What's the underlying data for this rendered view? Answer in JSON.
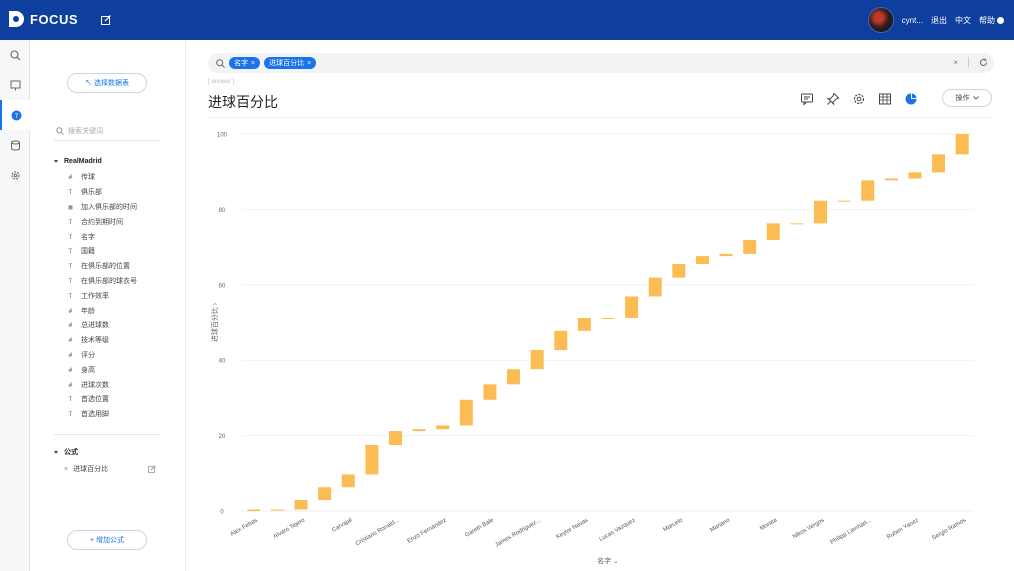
{
  "app": {
    "name": "FOCUS"
  },
  "user": {
    "name": "cynt...",
    "logout": "退出",
    "lang": "中文",
    "help": "帮助"
  },
  "sidebar": {
    "select_table": "↖ 选择数据表",
    "search_placeholder": "搜索关键词",
    "table_name": "RealMadrid",
    "fields": [
      {
        "icon": "number-field-icon",
        "glyph": "#",
        "label": "传球"
      },
      {
        "icon": "text-field-icon",
        "glyph": "T",
        "label": "俱乐部"
      },
      {
        "icon": "date-field-icon",
        "glyph": "▦",
        "label": "加入俱乐部的时间"
      },
      {
        "icon": "text-field-icon",
        "glyph": "T",
        "label": "合约到期时间"
      },
      {
        "icon": "text-field-icon",
        "glyph": "T",
        "label": "名字"
      },
      {
        "icon": "text-field-icon",
        "glyph": "T",
        "label": "国籍"
      },
      {
        "icon": "text-field-icon",
        "glyph": "T",
        "label": "在俱乐部的位置"
      },
      {
        "icon": "text-field-icon",
        "glyph": "T",
        "label": "在俱乐部的球衣号"
      },
      {
        "icon": "text-field-icon",
        "glyph": "T",
        "label": "工作效率"
      },
      {
        "icon": "number-field-icon",
        "glyph": "#",
        "label": "年龄"
      },
      {
        "icon": "number-field-icon",
        "glyph": "#",
        "label": "总进球数"
      },
      {
        "icon": "number-field-icon",
        "glyph": "#",
        "label": "技术等级"
      },
      {
        "icon": "number-field-icon",
        "glyph": "#",
        "label": "评分"
      },
      {
        "icon": "number-field-icon",
        "glyph": "#",
        "label": "身高"
      },
      {
        "icon": "number-field-icon",
        "glyph": "#",
        "label": "进球次数"
      },
      {
        "icon": "text-field-icon",
        "glyph": "T",
        "label": "首选位置"
      },
      {
        "icon": "text-field-icon",
        "glyph": "T",
        "label": "首选用脚"
      }
    ],
    "formula_group": "公式",
    "formula_item": "进球百分比",
    "add_formula": "+ 增加公式"
  },
  "query": {
    "chips": [
      "名字",
      "进球百分比"
    ]
  },
  "answer_tag": "[ answer ]",
  "answer_title": "进球百分比",
  "ops_label": "操作",
  "colors": {
    "accent": "#1a73e8",
    "topbar": "#0f3f9e",
    "bar": "#fbbc53"
  },
  "chart_data": {
    "type": "waterfall",
    "xlabel": "名字",
    "ylabel": "进球百分比",
    "ylim": [
      0,
      100
    ],
    "yticks": [
      0,
      20,
      40,
      60,
      80,
      100
    ],
    "grid": true,
    "x_tick_labels": [
      "Alex Febas",
      "Alvaro Tejero",
      "Carvajal",
      "Cristiano Ronald...",
      "Enzo Fernandez",
      "Gareth Bale",
      "James Rodriguez...",
      "Keylor Navas",
      "Lucas Vazquez",
      "Marcelo",
      "Mariano",
      "Morata",
      "Nikos Vergos",
      "Philipp Lienhart...",
      "Ruben Yanez",
      "Sergio Ramos"
    ],
    "segments": [
      {
        "start": 0,
        "end": 0.4
      },
      {
        "start": 0.4,
        "end": 0.4
      },
      {
        "start": 0.4,
        "end": 2.9
      },
      {
        "start": 2.9,
        "end": 6.3
      },
      {
        "start": 6.3,
        "end": 9.7
      },
      {
        "start": 9.7,
        "end": 17.5
      },
      {
        "start": 17.5,
        "end": 21.2
      },
      {
        "start": 21.2,
        "end": 21.7
      },
      {
        "start": 21.7,
        "end": 22.7
      },
      {
        "start": 22.7,
        "end": 29.5
      },
      {
        "start": 29.5,
        "end": 33.6
      },
      {
        "start": 33.6,
        "end": 37.6
      },
      {
        "start": 37.6,
        "end": 42.7
      },
      {
        "start": 42.7,
        "end": 47.8
      },
      {
        "start": 47.8,
        "end": 51.2
      },
      {
        "start": 51.2,
        "end": 51.2
      },
      {
        "start": 51.2,
        "end": 56.9
      },
      {
        "start": 56.9,
        "end": 61.9
      },
      {
        "start": 61.9,
        "end": 65.5
      },
      {
        "start": 65.5,
        "end": 67.6
      },
      {
        "start": 67.6,
        "end": 68.2
      },
      {
        "start": 68.2,
        "end": 71.9
      },
      {
        "start": 71.9,
        "end": 76.3
      },
      {
        "start": 76.3,
        "end": 76.3
      },
      {
        "start": 76.3,
        "end": 82.3
      },
      {
        "start": 82.3,
        "end": 82.3
      },
      {
        "start": 82.3,
        "end": 87.7
      },
      {
        "start": 87.7,
        "end": 88.2
      },
      {
        "start": 88.2,
        "end": 89.8
      },
      {
        "start": 89.8,
        "end": 94.6
      },
      {
        "start": 94.6,
        "end": 100
      }
    ]
  }
}
